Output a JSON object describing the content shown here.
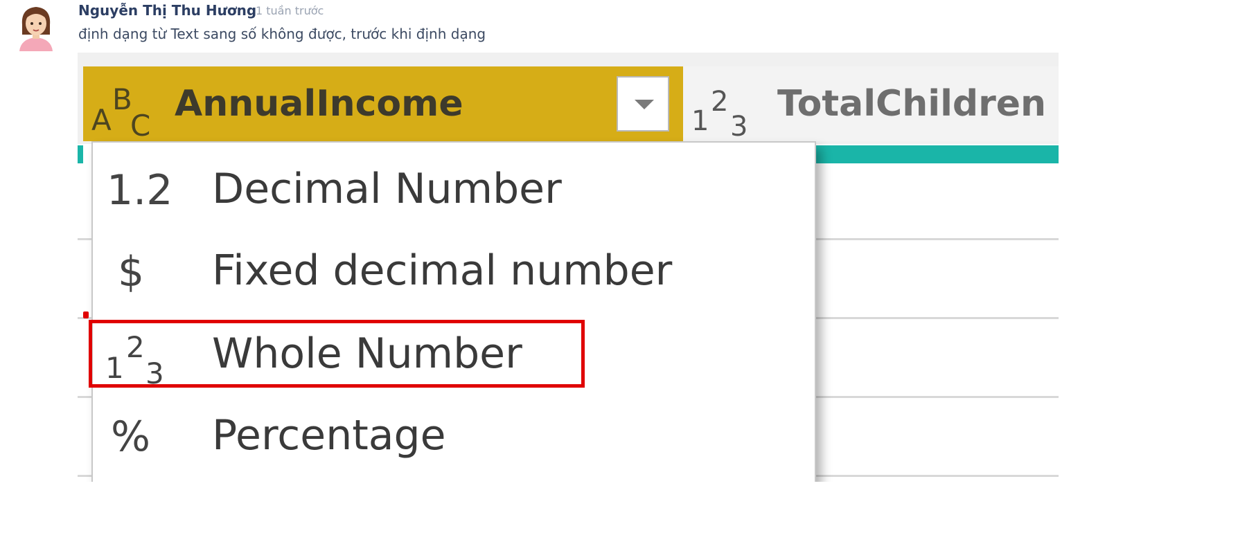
{
  "comment": {
    "author": "Nguyễn Thị Thu Hương",
    "time": "1 tuần trước",
    "text": "định dạng từ Text sang số không được, trước khi định dạng"
  },
  "screenshot": {
    "columns": [
      {
        "name": "AnnualIncome",
        "type_icon": "abc-text-type-icon",
        "selected": true
      },
      {
        "name": "TotalChildren",
        "type_icon": "123-whole-number-type-icon",
        "selected": false
      }
    ],
    "menu_items": [
      {
        "icon_text": "1.2",
        "icon": "decimal-icon",
        "label": "Decimal Number"
      },
      {
        "icon_text": "$",
        "icon": "dollar-icon",
        "label": "Fixed decimal number"
      },
      {
        "icon_text": "",
        "icon": "123-whole-number-type-icon",
        "label": "Whole Number",
        "highlighted": true
      },
      {
        "icon_text": "%",
        "icon": "percent-icon",
        "label": "Percentage"
      }
    ],
    "colors": {
      "selected_header": "#d6ad17",
      "highlight": "#e00000",
      "quality_bar": "#1ab5a8"
    }
  }
}
